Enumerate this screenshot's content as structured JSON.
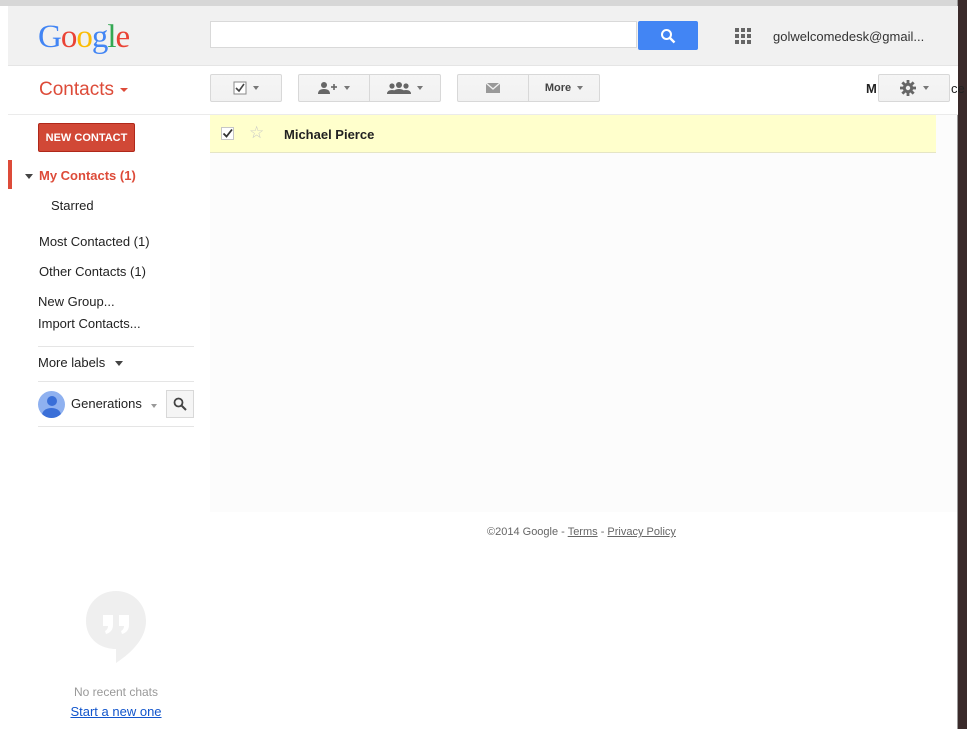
{
  "header": {
    "logo_text": "Google",
    "account": "golwelcomedesk@gmail...",
    "search_placeholder": ""
  },
  "toolbar": {
    "app_title": "Contacts",
    "more_label": "More",
    "stub_left": "M",
    "stub_right": "ce"
  },
  "sidebar": {
    "new_contact": "NEW CONTACT",
    "my_contacts": "My Contacts (1)",
    "starred": "Starred",
    "most_contacted": "Most Contacted (1)",
    "other_contacts": "Other Contacts (1)",
    "new_group": "New Group...",
    "import_contacts": "Import Contacts...",
    "more_labels": "More labels",
    "chat_user": "Generations"
  },
  "contacts": [
    {
      "name": "Michael Pierce",
      "checked": true,
      "starred": false
    }
  ],
  "footer": {
    "copyright": "©2014 Google",
    "dash": " - ",
    "terms": "Terms",
    "privacy": "Privacy Policy"
  },
  "chat": {
    "no_recent": "No recent chats",
    "start_new": "Start a new one"
  },
  "colors": {
    "accent_red": "#dd4b39",
    "button_red": "#d14836",
    "search_blue": "#4285f4",
    "row_highlight": "#ffffcc"
  }
}
